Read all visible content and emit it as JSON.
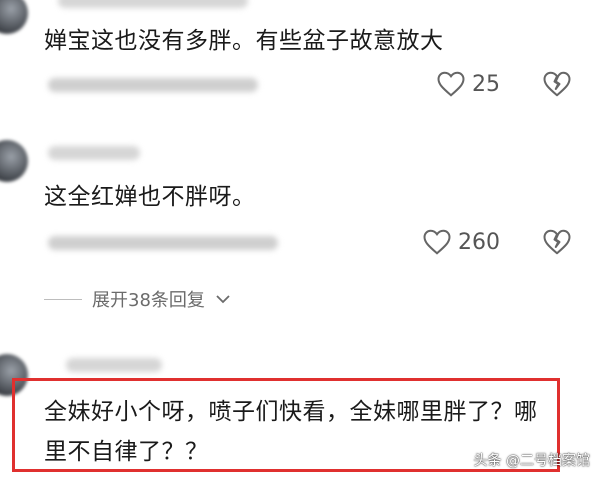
{
  "comments": [
    {
      "text": "婵宝这也没有多胖。有些盆子故意放大",
      "likes": "25"
    },
    {
      "text": "这全红婵也不胖呀。",
      "likes": "260"
    },
    {
      "text": "全妹好小个呀，喷子们快看，全妹哪里胖了？哪里不自律了？？"
    }
  ],
  "replies_label": "展开38条回复",
  "watermark": "头条 @二号档案馆",
  "colors": {
    "highlight_border": "#e0302f",
    "text": "#1a1a1a",
    "muted": "#6b6b6b"
  },
  "icons": {
    "like": "heart-outline-icon",
    "dislike": "broken-heart-icon",
    "expand": "chevron-down-icon"
  }
}
